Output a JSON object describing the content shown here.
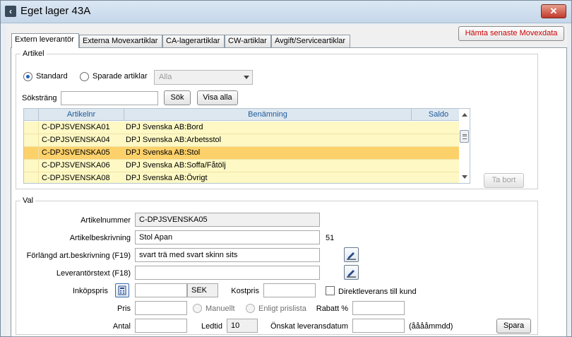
{
  "window": {
    "title": "Eget lager 43A",
    "close_label": "✕"
  },
  "tabs": [
    {
      "label": "Extern leverantör"
    },
    {
      "label": "Externa Movexartiklar"
    },
    {
      "label": "CA-lagerartiklar"
    },
    {
      "label": "CW-artiklar"
    },
    {
      "label": "Avgift/Serviceartiklar"
    }
  ],
  "fetch_button": "Hämta senaste Movexdata",
  "artikel": {
    "legend": "Artikel",
    "radio_standard": "Standard",
    "radio_saved": "Sparade artiklar",
    "saved_combo": "Alla",
    "search_label": "Söksträng",
    "search_value": "",
    "search_button": "Sök",
    "show_all_button": "Visa alla",
    "remove_button": "Ta bort"
  },
  "grid": {
    "headers": [
      "Artikelnr",
      "Benämning",
      "Saldo"
    ],
    "rows": [
      {
        "nr": "C-DPJSVENSKA01",
        "name": "DPJ Svenska AB:Bord",
        "saldo": ""
      },
      {
        "nr": "C-DPJSVENSKA04",
        "name": "DPJ Svenska AB:Arbetsstol",
        "saldo": ""
      },
      {
        "nr": "C-DPJSVENSKA05",
        "name": "DPJ Svenska AB:Stol",
        "saldo": ""
      },
      {
        "nr": "C-DPJSVENSKA06",
        "name": "DPJ Svenska AB:Soffa/Fåtölj",
        "saldo": ""
      },
      {
        "nr": "C-DPJSVENSKA08",
        "name": "DPJ Svenska AB:Övrigt",
        "saldo": ""
      }
    ],
    "selected_index": 2
  },
  "val": {
    "legend": "Val",
    "artikelnummer_label": "Artikelnummer",
    "artikelnummer": "C-DPJSVENSKA05",
    "beskrivning_label": "Artikelbeskrivning",
    "beskrivning": "Stol Apan",
    "beskrivning_count": "51",
    "forlangd_label": "Förlängd art.beskrivning (F19)",
    "forlangd": "svart trä med svart skinn sits",
    "leverantorstext_label": "Leverantörstext (F18)",
    "leverantorstext": "",
    "inkopspris_label": "Inköpspris",
    "inkopspris": "",
    "currency": "SEK",
    "kostpris_label": "Kostpris",
    "kostpris": "",
    "direkt_label": "Direktleverans till kund",
    "pris_label": "Pris",
    "pris": "",
    "manuellt_label": "Manuellt",
    "enligt_label": "Enligt prislista",
    "rabatt_label": "Rabatt %",
    "rabatt": "",
    "antal_label": "Antal",
    "antal": "",
    "ledtid_label": "Ledtid",
    "ledtid": "10",
    "datum_label": "Önskat leveransdatum",
    "datum": "",
    "datum_hint": "(ååååmmdd)",
    "save_button": "Spara"
  }
}
